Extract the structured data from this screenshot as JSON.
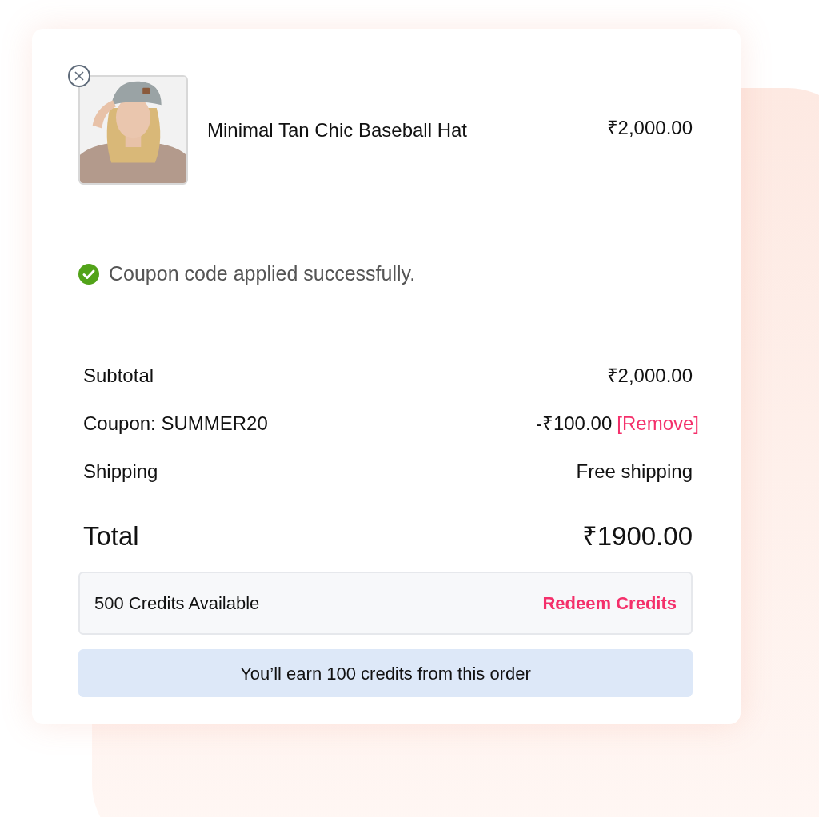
{
  "product": {
    "name": "Minimal Tan Chic Baseball Hat",
    "price": "₹2,000.00"
  },
  "notice": {
    "text": "Coupon code applied successfully."
  },
  "summary": [
    {
      "kind": "line",
      "label": "Subtotal",
      "value": "₹2,000.00"
    },
    {
      "kind": "coupon",
      "label": "Coupon: SUMMER20",
      "value": "-₹100.00",
      "action": "[Remove]"
    },
    {
      "kind": "line",
      "label": "Shipping",
      "value": "Free shipping"
    }
  ],
  "total": {
    "label": "Total",
    "value": "₹1900.00"
  },
  "credits": {
    "text": "500 Credits Available",
    "action": "Redeem Credits"
  },
  "earn_banner": {
    "text": "You’ll earn 100 credits from this order"
  }
}
